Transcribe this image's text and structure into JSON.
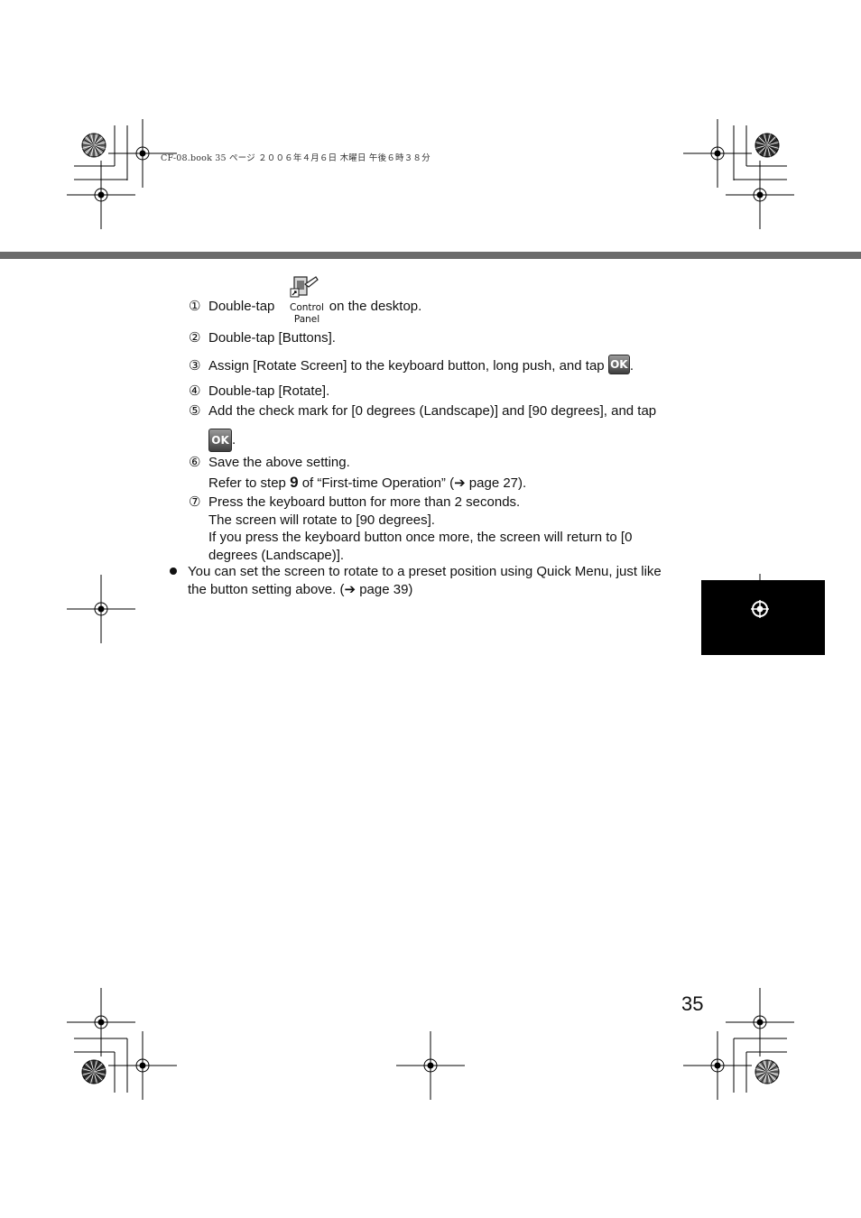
{
  "header": {
    "print_info": "CF-08.book   35 ページ   ２００６年４月６日   木曜日   午後６時３８分"
  },
  "desktop_icon": {
    "caption_line1": "Control",
    "caption_line2": "Panel",
    "icon_name": "control-panel-icon"
  },
  "ok_button": {
    "label": "OK"
  },
  "steps": [
    {
      "num": "①",
      "before_icon": "Double-tap",
      "after_icon": "on the desktop."
    },
    {
      "num": "②",
      "text": "Double-tap [Buttons]."
    },
    {
      "num": "③",
      "before_button": "Assign [Rotate Screen] to the keyboard button, long push, and tap",
      "after_button": "."
    },
    {
      "num": "④",
      "text": "Double-tap [Rotate]."
    },
    {
      "num": "⑤",
      "text": "Add the check mark for [0 degrees (Landscape)] and [90 degrees], and tap",
      "after_button": "."
    },
    {
      "num": "⑥",
      "line1": "Save the above setting.",
      "line2_before": "Refer to step",
      "step_ref": "9",
      "line2_after": "of “First-time Operation” (➔ page 27)."
    },
    {
      "num": "⑦",
      "line1": "Press the keyboard button for more than 2 seconds.",
      "line2": "The screen will rotate to [90 degrees].",
      "line3": "If you press the keyboard button once more, the screen will return to [0",
      "line4": "degrees (Landscape)]."
    }
  ],
  "note": {
    "line1": "You can set the screen to rotate to a preset position using Quick Menu, just like",
    "line2": "the button setting above. (➔ page 39)"
  },
  "page_number": "35",
  "colors": {
    "rule": "#6b6b6b",
    "tab": "#000000"
  }
}
